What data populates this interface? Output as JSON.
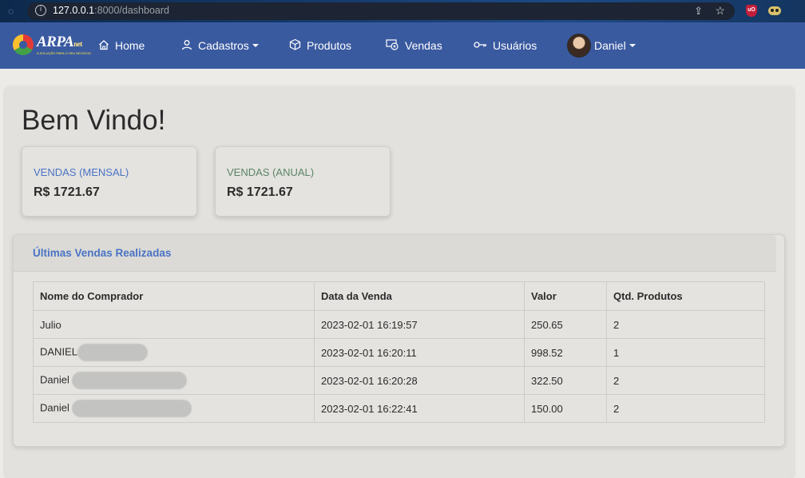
{
  "browser": {
    "url_host": "127.0.0.1",
    "url_path": ":8000/dashboard",
    "ext_badge": "uO"
  },
  "navbar": {
    "brand_name": "ARPA",
    "brand_suffix": "net",
    "brand_tagline": "A SOLUÇÃO PARA O SEU NEGÓCIO",
    "items": [
      {
        "label": "Home",
        "icon": "home-icon"
      },
      {
        "label": "Cadastros",
        "icon": "person-icon"
      },
      {
        "label": "Produtos",
        "icon": "box-icon"
      },
      {
        "label": "Vendas",
        "icon": "cash-icon"
      },
      {
        "label": "Usuários",
        "icon": "key-icon"
      }
    ],
    "user_name": "Daniel"
  },
  "page": {
    "title": "Bem Vindo!"
  },
  "stats": {
    "monthly_label": "VENDAS (MENSAL)",
    "monthly_value": "R$ 1721.67",
    "annual_label": "VENDAS (ANUAL)",
    "annual_value": "R$ 1721.67"
  },
  "sales": {
    "title": "Últimas Vendas Realizadas",
    "columns": [
      "Nome do Comprador",
      "Data da Venda",
      "Valor",
      "Qtd. Produtos"
    ],
    "rows": [
      {
        "name": "Julio",
        "date": "2023-02-01 16:19:57",
        "value": "250.65",
        "qty": "2"
      },
      {
        "name": "DANIEL",
        "date": "2023-02-01 16:20:11",
        "value": "998.52",
        "qty": "1"
      },
      {
        "name": "Daniel",
        "date": "2023-02-01 16:20:28",
        "value": "322.50",
        "qty": "2"
      },
      {
        "name": "Daniel",
        "date": "2023-02-01 16:22:41",
        "value": "150.00",
        "qty": "2"
      }
    ]
  },
  "colors": {
    "navbar": "#3a5aa0",
    "accent_blue": "#4a73c4",
    "accent_green": "#5b8465"
  }
}
